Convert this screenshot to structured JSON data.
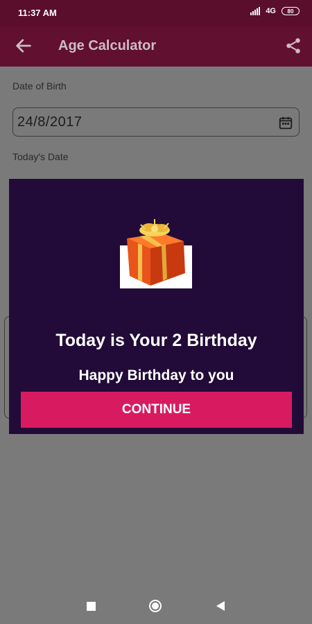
{
  "status_bar": {
    "time": "11:37 AM",
    "network": "4G",
    "battery": "80"
  },
  "app_bar": {
    "title": "Age Calculator",
    "back_icon": "arrow-left-icon",
    "share_icon": "share-icon"
  },
  "form": {
    "dob_label": "Date of Birth",
    "dob_value": "24/8/2017",
    "today_label": "Today's Date",
    "calendar_icon": "calendar-icon"
  },
  "dialog": {
    "icon": "gift-box-icon",
    "title": "Today is Your 2 Birthday",
    "subtitle": "Happy Birthday to you",
    "button_label": "CONTINUE",
    "background": "#220b38",
    "button_color": "#d81b60"
  },
  "nav_bar": {
    "recents_icon": "square-icon",
    "home_icon": "circle-icon",
    "back_icon": "triangle-back-icon"
  },
  "colors": {
    "primary_dark": "#5a0e2c",
    "primary": "#61102f",
    "scrim_bg": "#7a7a7a"
  }
}
